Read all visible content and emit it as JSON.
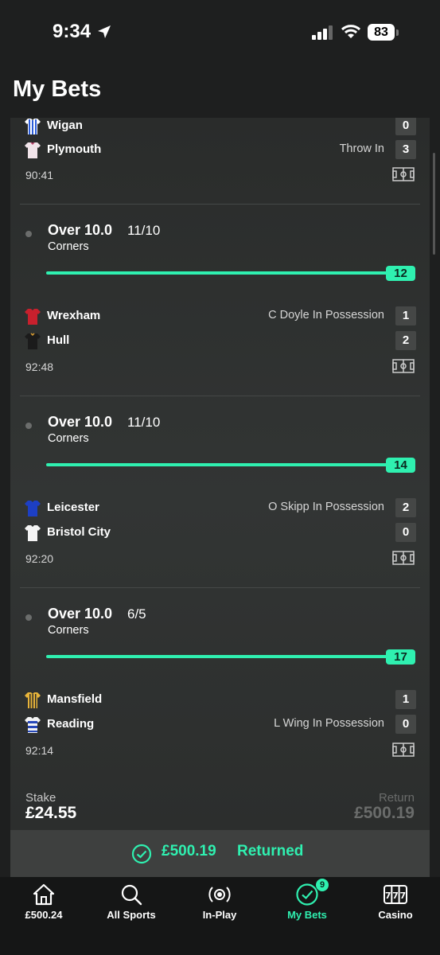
{
  "status_bar": {
    "time": "9:34",
    "battery": "83"
  },
  "header": {
    "title": "My Bets"
  },
  "partial_match": {
    "home": {
      "name": "Wigan",
      "score": "0"
    },
    "away": {
      "name": "Plymouth",
      "score": "3",
      "event": "Throw In"
    },
    "clock": "90:41"
  },
  "bets": [
    {
      "selection": "Over 10.0",
      "odds": "11/10",
      "market": "Corners",
      "progress_value": "12",
      "home": {
        "name": "Wrexham",
        "score": "1",
        "event": "C Doyle In Possession"
      },
      "away": {
        "name": "Hull",
        "score": "2",
        "event": ""
      },
      "clock": "92:48"
    },
    {
      "selection": "Over 10.0",
      "odds": "11/10",
      "market": "Corners",
      "progress_value": "14",
      "home": {
        "name": "Leicester",
        "score": "2",
        "event": "O Skipp In Possession"
      },
      "away": {
        "name": "Bristol City",
        "score": "0",
        "event": ""
      },
      "clock": "92:20"
    },
    {
      "selection": "Over 10.0",
      "odds": "6/5",
      "market": "Corners",
      "progress_value": "17",
      "home": {
        "name": "Mansfield",
        "score": "1",
        "event": ""
      },
      "away": {
        "name": "Reading",
        "score": "0",
        "event": "L Wing In Possession"
      },
      "clock": "92:14"
    }
  ],
  "summary": {
    "stake_label": "Stake",
    "stake_value": "£24.55",
    "return_label": "Return",
    "return_value": "£500.19",
    "returned_amount": "£500.19",
    "returned_label": "Returned"
  },
  "nav": {
    "balance": "£500.24",
    "sports": "All Sports",
    "inplay": "In-Play",
    "mybets": "My Bets",
    "mybets_badge": "9",
    "casino": "Casino"
  },
  "colors": {
    "accent": "#2ff0b0",
    "background": "#1e1f1f"
  }
}
